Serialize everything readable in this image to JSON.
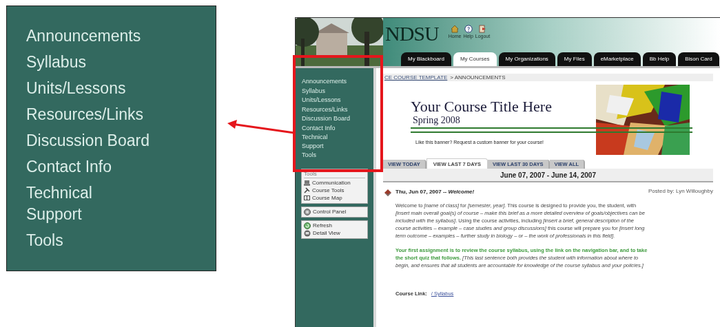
{
  "callout": {
    "items": [
      "Announcements",
      "Syllabus",
      "Units/Lessons",
      "Resources/Links",
      "Discussion Board",
      "Contact Info",
      "Technical\nSupport",
      "Tools"
    ]
  },
  "header": {
    "logo": "NDSU",
    "icons": [
      {
        "kind": "home",
        "label": "Home"
      },
      {
        "kind": "help",
        "label": "Help"
      },
      {
        "kind": "logout",
        "label": "Logout"
      }
    ],
    "tabs": [
      {
        "label": "My Blackboard",
        "selected": false
      },
      {
        "label": "My Courses",
        "selected": true
      },
      {
        "label": "My Organizations",
        "selected": false
      },
      {
        "label": "My Files",
        "selected": false
      },
      {
        "label": "eMarketplace",
        "selected": false
      },
      {
        "label": "Bb Help",
        "selected": false
      },
      {
        "label": "Bison Card",
        "selected": false
      }
    ]
  },
  "sidebar": {
    "items": [
      "Announcements",
      "Syllabus",
      "Units/Lessons",
      "Resources/Links",
      "Discussion Board",
      "Contact Info",
      "Technical\nSupport",
      "Tools"
    ],
    "tools_title": "Tools",
    "groups": [
      [
        {
          "kind": "communication",
          "label": "Communication"
        },
        {
          "kind": "course-tools",
          "label": "Course Tools"
        },
        {
          "kind": "course-map",
          "label": "Course Map"
        }
      ],
      [
        {
          "kind": "control-panel",
          "label": "Control Panel"
        }
      ],
      [
        {
          "kind": "refresh",
          "label": "Refresh"
        },
        {
          "kind": "detail-view",
          "label": "Detail View"
        }
      ]
    ]
  },
  "breadcrumb": {
    "link": "CE COURSE TEMPLATE",
    "current": "> ANNOUNCEMENTS"
  },
  "banner": {
    "title": "Your Course Title Here",
    "subtitle": "Spring 2008",
    "note": "Like this banner?  Request a custom banner for your course!"
  },
  "view_tabs": [
    {
      "label": "VIEW TODAY",
      "selected": false
    },
    {
      "label": "VIEW LAST 7 DAYS",
      "selected": true
    },
    {
      "label": "VIEW LAST 30 DAYS",
      "selected": false
    },
    {
      "label": "VIEW ALL",
      "selected": false
    }
  ],
  "date_range": "June 07, 2007 - June 14, 2007",
  "announcement": {
    "heading": "Thu, Jun 07, 2007 -- *Welcome!*",
    "posted_by": "Posted by: Lyn Willoughby",
    "paragraphs": [
      "Welcome to *[name of class]* for *[semester, year]*. This course is designed to provide you, the student, with *[insert main overall goal(s) of course – make this brief as a more detailed overview of goals/objectives can be included with the syllabus]*. Using the course activities, including *[insert a brief, general description of the course activities – example – case studies and group discussions]* this course will prepare you for *[insert long term outcome – examples – further study in biology – or – the work of professionals in this field]*.",
      "**Your first assignment is to review the course syllabus, using the link on the navigation bar, and to take the short quiz that follows.** *[This last sentence both provides the student with information about where to begin, and ensures that all students are accountable for knowledge of the course syllabus and your policies.]*"
    ],
    "course_link_label": "Course Link:",
    "course_link": "/ Syllabus"
  }
}
